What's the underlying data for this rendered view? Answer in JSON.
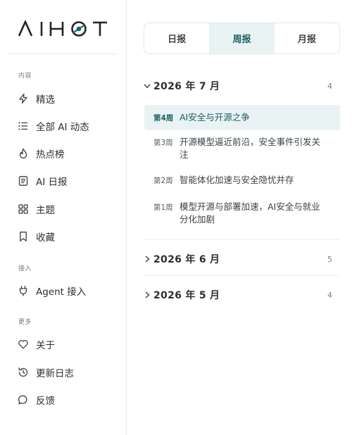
{
  "sidebar": {
    "logo_text": "AIHOT",
    "sections": [
      {
        "label": "内容"
      },
      {
        "label": "接入"
      },
      {
        "label": "更多"
      }
    ],
    "items": [
      {
        "label": "精选",
        "icon": "lightning-icon"
      },
      {
        "label": "全部 AI 动态",
        "icon": "list-icon"
      },
      {
        "label": "热点榜",
        "icon": "flame-icon"
      },
      {
        "label": "AI 日报",
        "icon": "document-icon"
      },
      {
        "label": "主题",
        "icon": "grid-icon"
      },
      {
        "label": "收藏",
        "icon": "bookmark-icon"
      },
      {
        "label": "Agent 接入",
        "icon": "plug-icon"
      },
      {
        "label": "关于",
        "icon": "heart-icon"
      },
      {
        "label": "更新日志",
        "icon": "history-icon"
      },
      {
        "label": "反馈",
        "icon": "chat-bubble-icon"
      }
    ]
  },
  "tabs": [
    {
      "label": "日报",
      "active": false
    },
    {
      "label": "周报",
      "active": true
    },
    {
      "label": "月报",
      "active": false
    }
  ],
  "months": [
    {
      "title": "2026 年 7 月",
      "count": "4",
      "expanded": true,
      "weeks": [
        {
          "num": "第4周",
          "title": "AI安全与开源之争",
          "active": true
        },
        {
          "num": "第3周",
          "title": "开源模型逼近前沿，安全事件引发关注",
          "active": false
        },
        {
          "num": "第2周",
          "title": "智能体化加速与安全隐忧并存",
          "active": false
        },
        {
          "num": "第1周",
          "title": "模型开源与部署加速，AI安全与就业分化加剧",
          "active": false
        }
      ]
    },
    {
      "title": "2026 年 6 月",
      "count": "5",
      "expanded": false
    },
    {
      "title": "2026 年 5 月",
      "count": "4",
      "expanded": false
    }
  ],
  "colors": {
    "accent": "#1e5f63",
    "active_bg": "#e9f3f3",
    "logo": "#1f2428"
  }
}
